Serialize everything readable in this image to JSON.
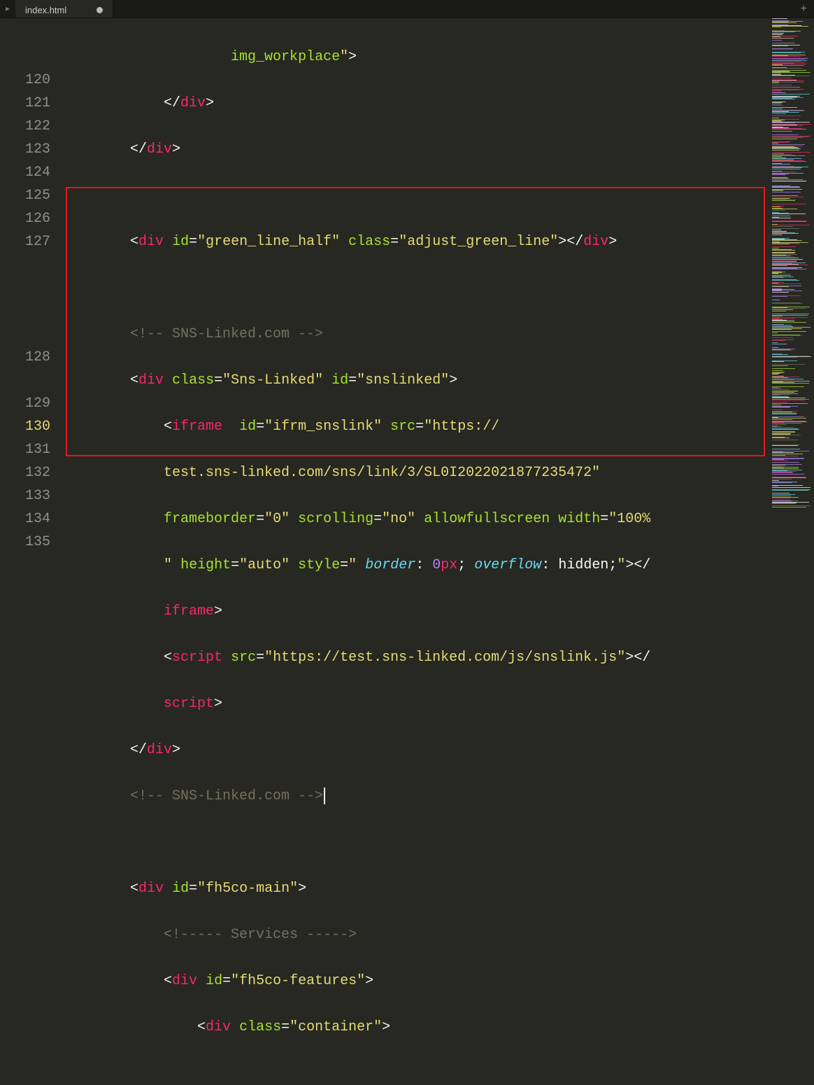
{
  "tab": {
    "filename": "index.html",
    "dirty": true
  },
  "gutter": {
    "start": 120,
    "end": 135,
    "visible": [
      "",
      "",
      "",
      "120",
      "121",
      "122",
      "123",
      "124",
      "125",
      "126",
      "127",
      "",
      "",
      "",
      "",
      "128",
      "",
      "129",
      "130",
      "131",
      "132",
      "133",
      "134",
      "135"
    ],
    "current": "130"
  },
  "code_lines": {
    "l0": "                    img_workplace\">",
    "l120": "            </div>",
    "l121": "        </div>",
    "l122": "",
    "l123": "        <div id=\"green_line_half\" class=\"adjust_green_line\"></div>",
    "l124": "",
    "l125": "        <!-- SNS-Linked.com -->",
    "l126": "        <div class=\"Sns-Linked\" id=\"snslinked\">",
    "l127a": "            <iframe  id=\"ifrm_snslink\" src=\"https://",
    "l127b": "            test.sns-linked.com/sns/link/3/SL0I2022021877235472\" ",
    "l127c": "            frameborder=\"0\" scrolling=\"no\" allowfullscreen width=\"100%",
    "l127d": "            \" height=\"auto\" style=\" border: 0px; overflow: hidden;\"></",
    "l127e": "            iframe>",
    "l128a": "            <script src=\"https://test.sns-linked.com/js/snslink.js\"></",
    "l128b": "            script>",
    "l129": "        </div>",
    "l130": "        <!-- SNS-Linked.com -->",
    "l131": "",
    "l132": "        <div id=\"fh5co-main\">",
    "l133": "            <!----- Services ----->",
    "l134": "            <div id=\"fh5co-features\">",
    "l135": "                <div class=\"container\">"
  },
  "colors": {
    "bg": "#272822",
    "tag": "#f92672",
    "attr": "#a6e22e",
    "string": "#e6db74",
    "comment": "#75715e",
    "prop": "#66d9ef",
    "num": "#ae81ff",
    "highlight_border": "#e11919"
  }
}
